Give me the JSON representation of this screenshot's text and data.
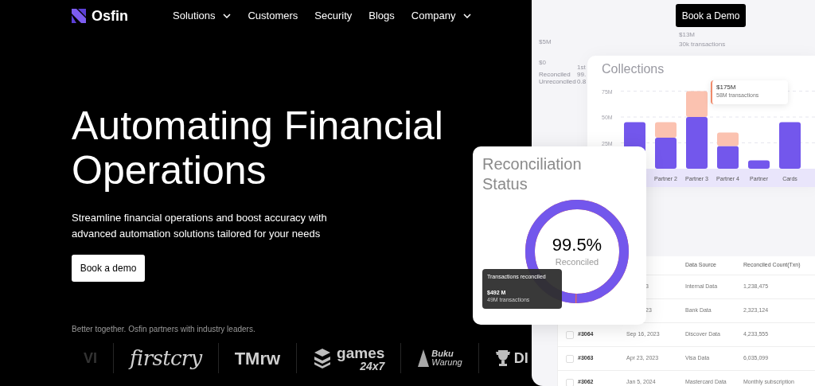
{
  "brand": {
    "name": "Osfin"
  },
  "nav": [
    {
      "label": "Solutions",
      "has_menu": true
    },
    {
      "label": "Customers",
      "has_menu": false
    },
    {
      "label": "Security",
      "has_menu": false
    },
    {
      "label": "Blogs",
      "has_menu": false
    },
    {
      "label": "Company",
      "has_menu": true
    }
  ],
  "cta_top": "Book a Demo",
  "hero": {
    "title": "Automating Financial Operations",
    "subtitle": "Streamline financial operations and boost accuracy with advanced automation solutions tailored for your needs",
    "button": "Book a demo"
  },
  "partners": {
    "caption": "Better together. Osfin partners with industry leaders.",
    "logos": [
      {
        "kind": "faded",
        "text": "VI"
      },
      {
        "kind": "script",
        "text": "firstcry"
      },
      {
        "kind": "bold",
        "text": "TMrw"
      },
      {
        "kind": "stack",
        "text": "games",
        "sub": "24x7"
      },
      {
        "kind": "tent",
        "text": "Buku",
        "sub": "Warung"
      },
      {
        "kind": "trophy",
        "text": "DI"
      }
    ]
  },
  "back_card": {
    "ticks": [
      "$5M",
      "$0"
    ],
    "legend": [
      "Reconciled",
      "Unreconciled"
    ],
    "column_head": "1st",
    "column_values": [
      "99.",
      "0.8"
    ],
    "tooltip_value": "$13M",
    "tooltip_sub": "30k transactions"
  },
  "collections": {
    "title": "Collections",
    "tooltip": {
      "value": "$175M",
      "sub": "58M transactions"
    },
    "chart_data": {
      "type": "bar",
      "stacked": true,
      "categories": [
        null,
        "Partner 2",
        "Partner 3",
        "Partner 4",
        "Partner",
        "Cards"
      ],
      "ylim": [
        0,
        75
      ],
      "grid": true,
      "yticks": [
        {
          "value": 25,
          "label": "25M"
        },
        {
          "value": 50,
          "label": "50M"
        },
        {
          "value": 75,
          "label": "75M"
        }
      ],
      "series": [
        {
          "color": "#7357ec",
          "values": [
            45,
            30,
            50,
            22,
            8,
            45
          ]
        },
        {
          "color": "#fbc2b0",
          "values": [
            0,
            15,
            25,
            13,
            0,
            0
          ]
        }
      ]
    }
  },
  "reconciliation": {
    "title": "Reconciliation Status",
    "level": 0.995,
    "reading": "99.5%",
    "label": "Reconciled",
    "tooltip": {
      "title": "Transactions reconciled",
      "value": "$492 M",
      "sub": "49M transactions"
    }
  },
  "table": {
    "columns": [
      "Data Source",
      "Reconciled Count(Txn)"
    ],
    "rows": [
      {
        "date": "3",
        "source": "Internal Data",
        "count": "1,238,475"
      },
      {
        "date": "23",
        "source": "Bank Data",
        "count": "2,323,124"
      },
      {
        "id": "#3064",
        "checked": false,
        "date": "Sep 16, 2023",
        "source": "Discover Data",
        "count": "4,233,555"
      },
      {
        "id": "#3063",
        "checked": false,
        "date": "Apr 23, 2023",
        "source": "Visa Data",
        "count": "6,035,099"
      },
      {
        "id": "#3062",
        "checked": false,
        "date": "Jan 5, 2024",
        "source": "Mastercard Data",
        "count": "Monthly subscription"
      }
    ]
  }
}
